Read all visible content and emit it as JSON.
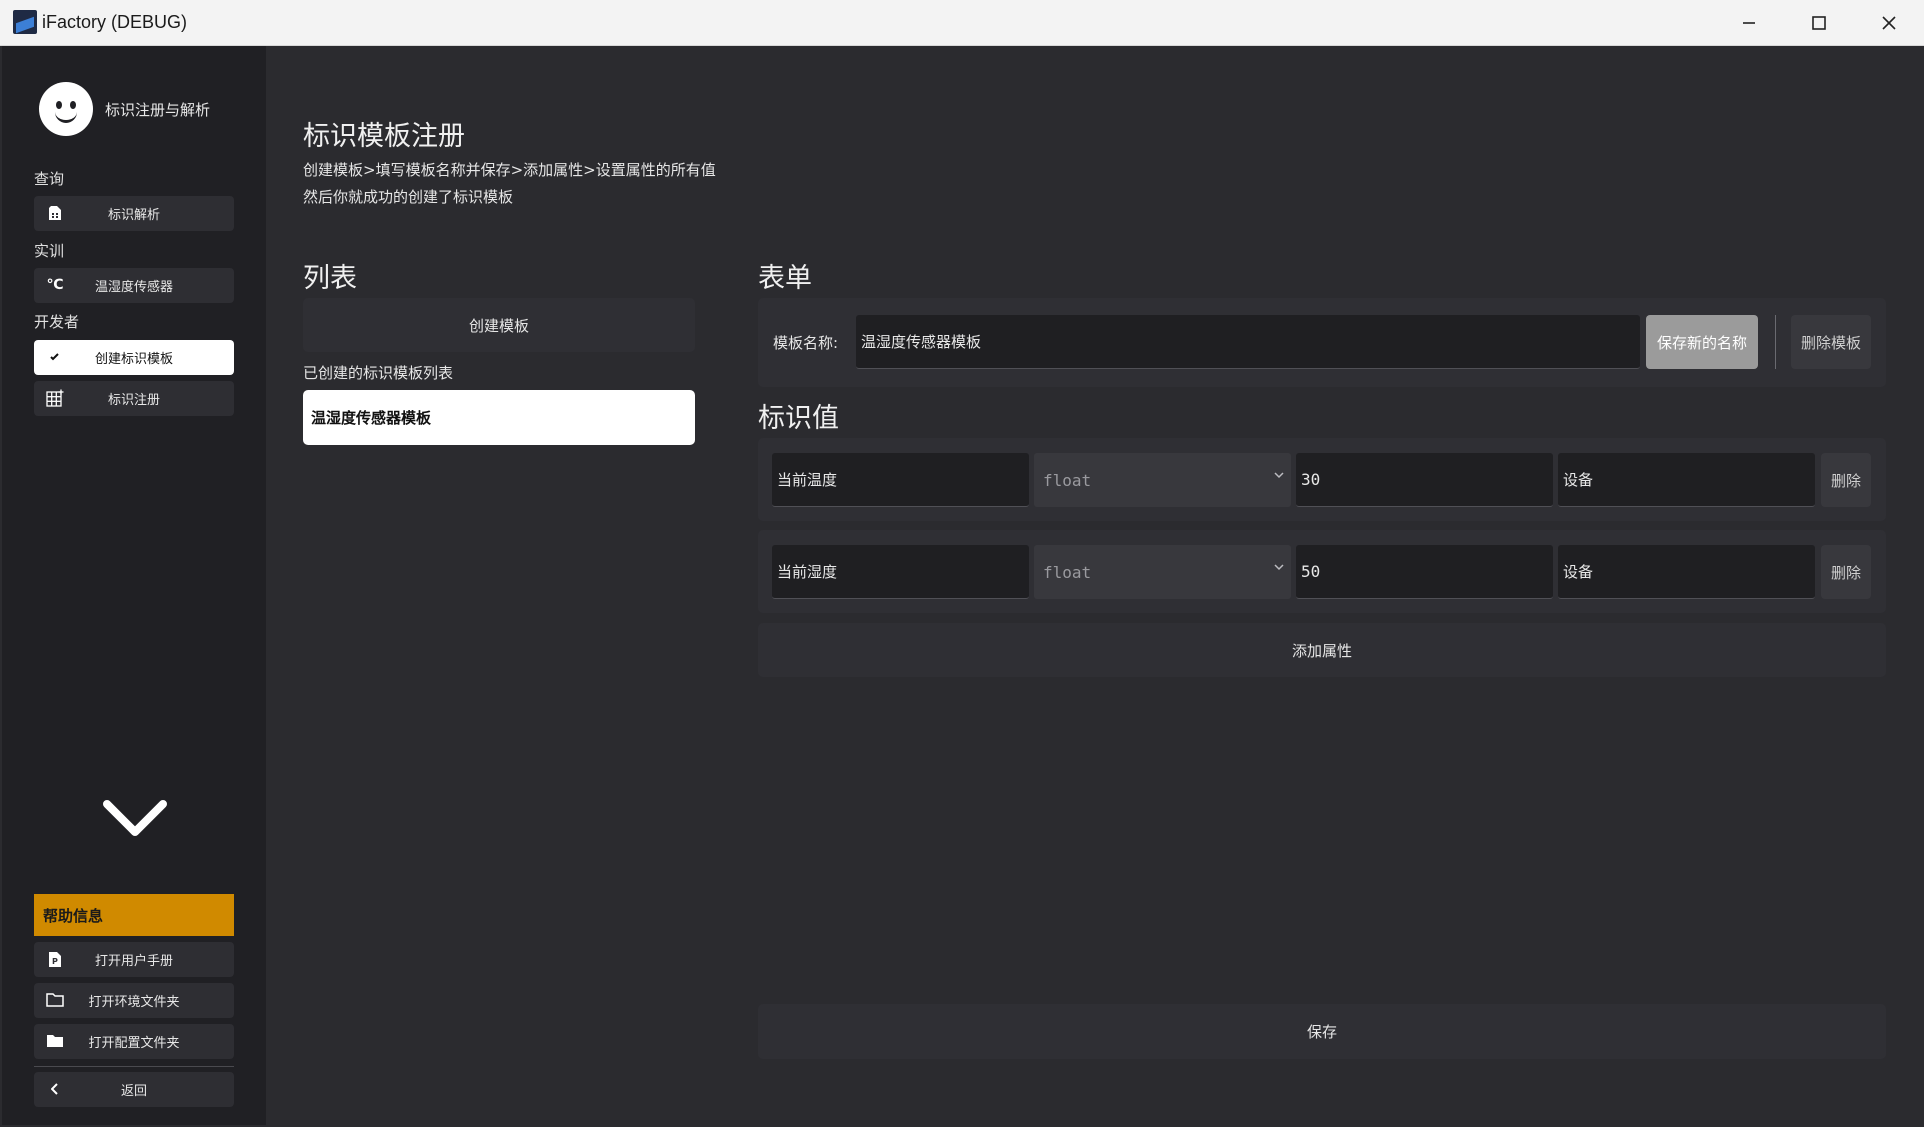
{
  "window": {
    "title": "iFactory (DEBUG)"
  },
  "sidebar": {
    "profile_name": "标识注册与解析",
    "sections": [
      {
        "label": "查询",
        "items": [
          {
            "label": "标识解析",
            "icon": "sim-card-icon"
          }
        ]
      },
      {
        "label": "实训",
        "items": [
          {
            "label": "温湿度传感器",
            "icon": "celsius-icon",
            "icon_text": "℃"
          }
        ]
      },
      {
        "label": "开发者",
        "items": [
          {
            "label": "创建标识模板",
            "icon": "check-icon",
            "active": true
          },
          {
            "label": "标识注册",
            "icon": "grid-add-icon"
          }
        ]
      }
    ],
    "help": {
      "header": "帮助信息",
      "items": [
        {
          "label": "打开用户手册",
          "icon": "pdf-file-icon"
        },
        {
          "label": "打开环境文件夹",
          "icon": "folder-outline-icon"
        },
        {
          "label": "打开配置文件夹",
          "icon": "folder-filled-icon"
        }
      ],
      "back": "返回"
    }
  },
  "main": {
    "title": "标识模板注册",
    "desc_line1": "创建模板>填写模板名称并保存>添加属性>设置属性的所有值",
    "desc_line2": "然后你就成功的创建了标识模板",
    "list": {
      "title": "列表",
      "create_button": "创建模板",
      "caption": "已创建的标识模板列表",
      "items": [
        "温湿度传感器模板"
      ]
    },
    "form": {
      "title": "表单",
      "name_label": "模板名称:",
      "name_value": "温湿度传感器模板",
      "save_name_button": "保存新的名称",
      "delete_template_button": "删除模板",
      "values_title": "标识值",
      "rows": [
        {
          "name": "当前温度",
          "type": "float",
          "value": "30",
          "unit": "设备",
          "delete": "删除"
        },
        {
          "name": "当前湿度",
          "type": "float",
          "value": "50",
          "unit": "设备",
          "delete": "删除"
        }
      ],
      "add_attribute_button": "添加属性",
      "save_button": "保存"
    }
  },
  "colors": {
    "accent": "#d08a00",
    "background": "#2b2b2f",
    "sidebar": "#202024"
  }
}
